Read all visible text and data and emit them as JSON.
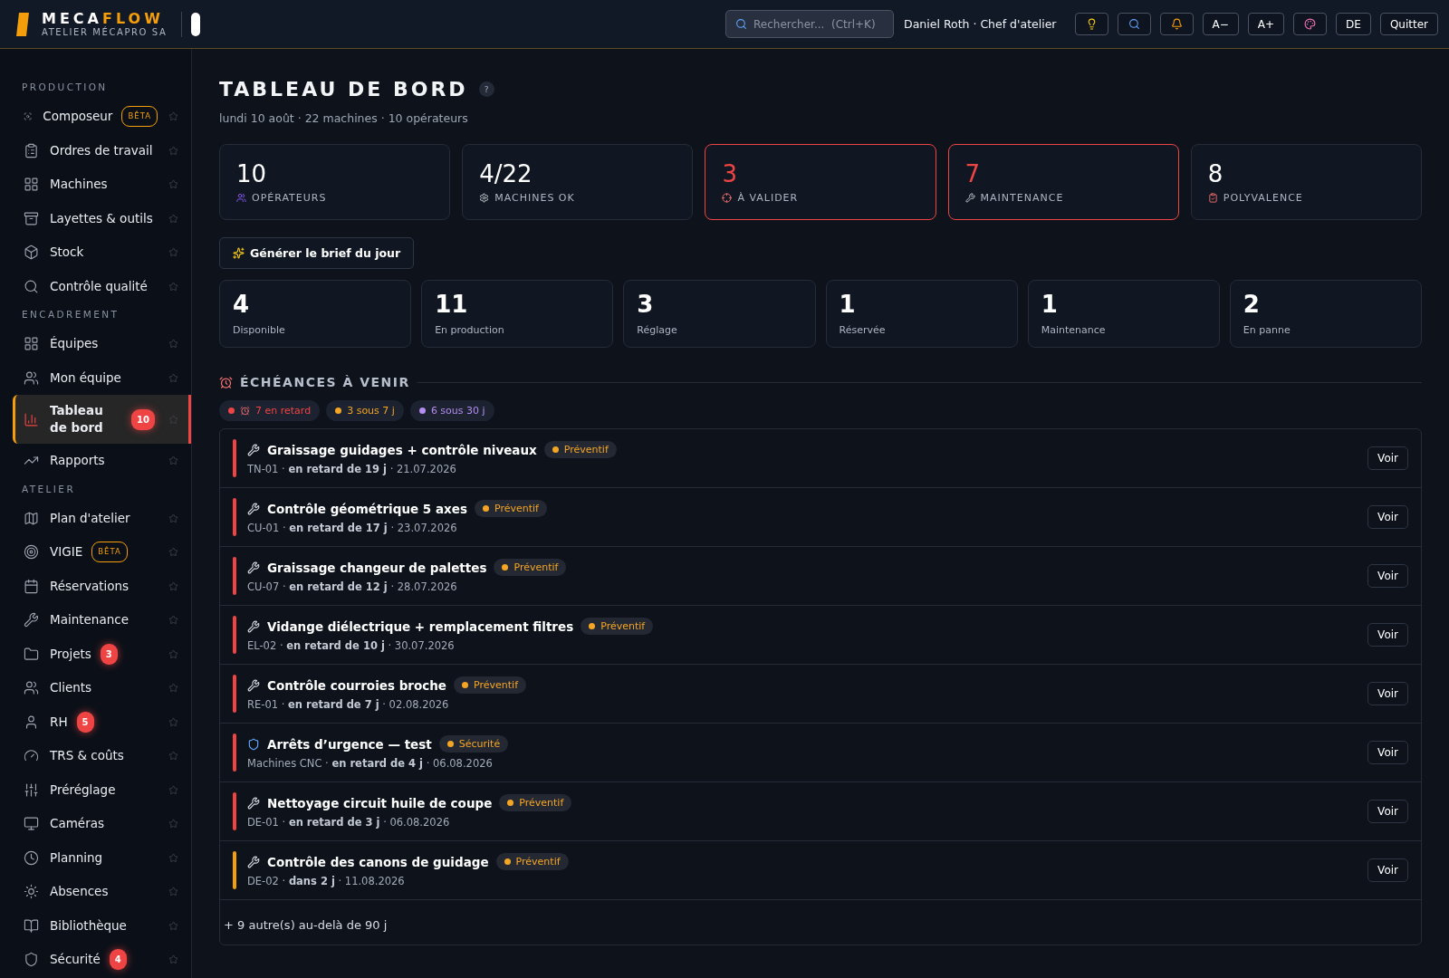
{
  "brand": {
    "name_part_1": "MECA",
    "name_part_2": "FLOW",
    "subtitle": "ATELIER MÉCAPRO SA"
  },
  "header": {
    "search": {
      "placeholder": "Rechercher...  (Ctrl+K)"
    },
    "user": "Daniel Roth · Chef d'atelier",
    "buttons": [
      {
        "kind": "icon"
      },
      {
        "kind": "icon"
      },
      {
        "kind": "icon"
      },
      {
        "kind": "text",
        "label": "A−"
      },
      {
        "kind": "text",
        "label": "A+"
      },
      {
        "kind": "icon"
      },
      {
        "kind": "text",
        "label": "DE"
      },
      {
        "kind": "text",
        "label": "Quitter"
      }
    ]
  },
  "sidebar": {
    "sections": [
      {
        "title": "PRODUCTION",
        "items": [
          {
            "label": "Composeur",
            "selected": false,
            "tag": "BÊTA"
          },
          {
            "label": "Ordres de travail",
            "selected": false
          },
          {
            "label": "Machines",
            "selected": false
          },
          {
            "label": "Layettes & outils",
            "selected": false
          },
          {
            "label": "Stock",
            "selected": false
          },
          {
            "label": "Contrôle qualité",
            "selected": false
          }
        ]
      },
      {
        "title": "ENCADREMENT",
        "items": [
          {
            "label": "Équipes",
            "selected": false
          },
          {
            "label": "Mon équipe",
            "selected": false
          },
          {
            "label": "Tableau de bord",
            "selected": true,
            "badge": "10"
          },
          {
            "label": "Rapports",
            "selected": false
          }
        ]
      },
      {
        "title": "ATELIER",
        "items": [
          {
            "label": "Plan d'atelier",
            "selected": false
          },
          {
            "label": "VIGIE",
            "selected": false,
            "tag": "BÊTA"
          },
          {
            "label": "Réservations",
            "selected": false
          },
          {
            "label": "Maintenance",
            "selected": false
          },
          {
            "label": "Projets",
            "selected": false,
            "badge": "3"
          },
          {
            "label": "Clients",
            "selected": false
          },
          {
            "label": "RH",
            "selected": false,
            "badge": "5"
          },
          {
            "label": "TRS & coûts",
            "selected": false
          },
          {
            "label": "Préréglage",
            "selected": false
          },
          {
            "label": "Caméras",
            "selected": false
          },
          {
            "label": "Planning",
            "selected": false
          },
          {
            "label": "Absences",
            "selected": false
          },
          {
            "label": "Bibliothèque",
            "selected": false
          },
          {
            "label": "Sécurité",
            "selected": false,
            "badge": "4"
          }
        ]
      }
    ]
  },
  "page": {
    "title": "TABLEAU DE BORD",
    "help": "?",
    "subtitle": "lundi 10 août · 22 machines · 10 opérateurs"
  },
  "kpis": [
    {
      "value": "10",
      "label": "OPÉRATEURS",
      "alert": false
    },
    {
      "value": "4/22",
      "label": "MACHINES OK",
      "alert": false
    },
    {
      "value": "3",
      "label": "À VALIDER",
      "alert": true
    },
    {
      "value": "7",
      "label": "MAINTENANCE",
      "alert": true
    },
    {
      "value": "8",
      "label": "POLYVALENCE",
      "alert": false
    }
  ],
  "brief_button": "Générer le brief du jour",
  "machine_states": [
    {
      "value": "4",
      "label": "Disponible"
    },
    {
      "value": "11",
      "label": "En production"
    },
    {
      "value": "3",
      "label": "Réglage"
    },
    {
      "value": "1",
      "label": "Réservée"
    },
    {
      "value": "1",
      "label": "Maintenance"
    },
    {
      "value": "2",
      "label": "En panne"
    }
  ],
  "deadlines": {
    "title": "ÉCHÉANCES À VENIR",
    "filters": [
      {
        "label": "7 en retard",
        "color": "#ef4444",
        "alarm": true
      },
      {
        "label": "3 sous 7 j",
        "color": "#f5a524",
        "alarm": false
      },
      {
        "label": "6 sous 30 j",
        "color": "#b48cf2",
        "alarm": false
      }
    ],
    "items": [
      {
        "kind": "preventive",
        "title": "Graissage guidages + contrôle niveaux",
        "tag": "Préventif",
        "meta": "TN-01 · **en retard de 19 j** · 21.07.2026",
        "overdue": true,
        "action": "Voir"
      },
      {
        "kind": "preventive",
        "title": "Contrôle géométrique 5 axes",
        "tag": "Préventif",
        "meta": "CU-01 · **en retard de 17 j** · 23.07.2026",
        "overdue": true,
        "action": "Voir"
      },
      {
        "kind": "preventive",
        "title": "Graissage changeur de palettes",
        "tag": "Préventif",
        "meta": "CU-07 · **en retard de 12 j** · 28.07.2026",
        "overdue": true,
        "action": "Voir"
      },
      {
        "kind": "preventive",
        "title": "Vidange diélectrique + remplacement filtres",
        "tag": "Préventif",
        "meta": "EL-02 · **en retard de 10 j** · 30.07.2026",
        "overdue": true,
        "action": "Voir"
      },
      {
        "kind": "preventive",
        "title": "Contrôle courroies broche",
        "tag": "Préventif",
        "meta": "RE-01 · **en retard de 7 j** · 02.08.2026",
        "overdue": true,
        "action": "Voir"
      },
      {
        "kind": "safety",
        "title": "Arrêts d’urgence — test",
        "tag": "Sécurité",
        "meta": "Machines CNC · **en retard de 4 j** · 06.08.2026",
        "overdue": true,
        "action": "Voir"
      },
      {
        "kind": "preventive",
        "title": "Nettoyage circuit huile de coupe",
        "tag": "Préventif",
        "meta": "DE-01 · **en retard de 3 j** · 06.08.2026",
        "overdue": true,
        "action": "Voir"
      },
      {
        "kind": "preventive",
        "title": "Contrôle des canons de guidage",
        "tag": "Préventif",
        "meta": "DE-02 · **dans 2 j** · 11.08.2026",
        "overdue": false,
        "action": "Voir"
      }
    ],
    "more": "+ 9 autre(s) au-delà de 90 j"
  }
}
